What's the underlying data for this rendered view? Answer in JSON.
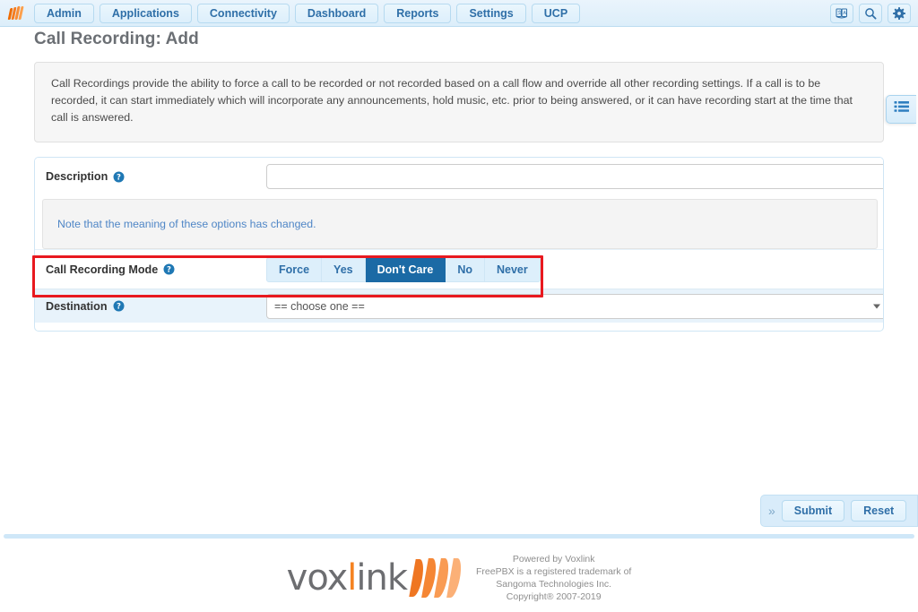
{
  "navbar": {
    "logo_icon": "voxlink-chevron-logo",
    "tabs": [
      {
        "label": "Admin"
      },
      {
        "label": "Applications"
      },
      {
        "label": "Connectivity"
      },
      {
        "label": "Dashboard"
      },
      {
        "label": "Reports"
      },
      {
        "label": "Settings"
      },
      {
        "label": "UCP"
      }
    ],
    "right_icons": [
      {
        "name": "language-icon"
      },
      {
        "name": "search-icon"
      },
      {
        "name": "gear-icon"
      }
    ]
  },
  "page": {
    "title": "Call Recording: Add",
    "info_text": "Call Recordings provide the ability to force a call to be recorded or not recorded based on a call flow and override all other recording settings. If a call is to be recorded, it can start immediately which will incorporate any announcements, hold music, etc. prior to being answered, or it can have recording start at the time that call is answered.",
    "side_tab_icon": "list-icon"
  },
  "form": {
    "description": {
      "label": "Description",
      "help_icon": "help-circle-icon",
      "value": "",
      "placeholder": ""
    },
    "note": "Note that the meaning of these options has changed.",
    "call_recording_mode": {
      "label": "Call Recording Mode",
      "help_icon": "help-circle-icon",
      "options": [
        "Force",
        "Yes",
        "Don't Care",
        "No",
        "Never"
      ],
      "selected": "Don't Care"
    },
    "destination": {
      "label": "Destination",
      "help_icon": "help-circle-icon",
      "selected": "== choose one ==",
      "caret_icon": "chevron-down-icon"
    }
  },
  "highlight": {
    "color": "#e8191f",
    "target": "call-recording-mode-row"
  },
  "actions": {
    "toggle_glyph": "»",
    "submit_label": "Submit",
    "reset_label": "Reset"
  },
  "footer": {
    "logo_text_1": "vox",
    "logo_text_accent": "l",
    "logo_text_2": "ink",
    "lines": [
      "Powered by Voxlink",
      "FreePBX is a registered trademark of",
      "Sangoma Technologies Inc.",
      "Copyright® 2007-2019"
    ]
  },
  "colors": {
    "accent_blue": "#1b6aa5",
    "nav_blue": "#2f6fa8",
    "brand_orange": "#f58220",
    "highlight_red": "#e8191f"
  }
}
